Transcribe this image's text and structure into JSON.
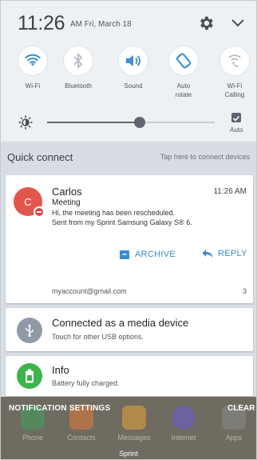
{
  "status": {
    "time": "11:26",
    "ampm_date": "AM Fri, March 18"
  },
  "quick_settings": [
    {
      "label": "Wi-Fi",
      "icon": "wifi-icon",
      "active": true
    },
    {
      "label": "Bluetooth",
      "icon": "bluetooth-icon",
      "active": false
    },
    {
      "label": "Sound",
      "icon": "sound-icon",
      "active": true
    },
    {
      "label": "Auto\nrotate",
      "icon": "auto-rotate-icon",
      "active": true
    },
    {
      "label": "Wi-Fi\nCalling",
      "icon": "wifi-calling-icon",
      "active": false
    }
  ],
  "brightness": {
    "level": 0.55,
    "auto_label": "Auto",
    "auto_checked": true
  },
  "quick_connect": {
    "title": "Quick connect",
    "hint": "Tap here to connect devices"
  },
  "email_notification": {
    "avatar_letter": "C",
    "sender": "Carlos",
    "time": "11:26 AM",
    "subject": "Meeting",
    "body_line1": "Hi, the meeting has been rescheduled.",
    "body_line2": "Sent from my Sprint Samsung Galaxy S® 6.",
    "archive_label": "ARCHIVE",
    "reply_label": "REPLY",
    "account": "myaccount@gmail.com",
    "count": "3"
  },
  "usb_notification": {
    "title": "Connected as a media device",
    "subtitle": "Touch for other USB options."
  },
  "battery_notification": {
    "title": "Info",
    "subtitle": "Battery fully charged."
  },
  "footer": {
    "settings_label": "NOTIFICATION SETTINGS",
    "clear_label": "CLEAR",
    "carrier": "Sprint"
  },
  "dock": [
    {
      "label": "Phone",
      "color": "#3fa35b"
    },
    {
      "label": "Contacts",
      "color": "#e07b3a"
    },
    {
      "label": "Messages",
      "color": "#e8a43a"
    },
    {
      "label": "Internet",
      "color": "#6b5ad6"
    },
    {
      "label": "Apps",
      "color": "#8a8a8a"
    }
  ],
  "colors": {
    "accent": "#3a8bcf",
    "quick_setting_active": "#3b8fd6",
    "quick_setting_inactive": "#b4bcc5",
    "avatar": "#e2574c",
    "usb_circle": "#8f9aa6",
    "battery_circle": "#3cb44b"
  }
}
